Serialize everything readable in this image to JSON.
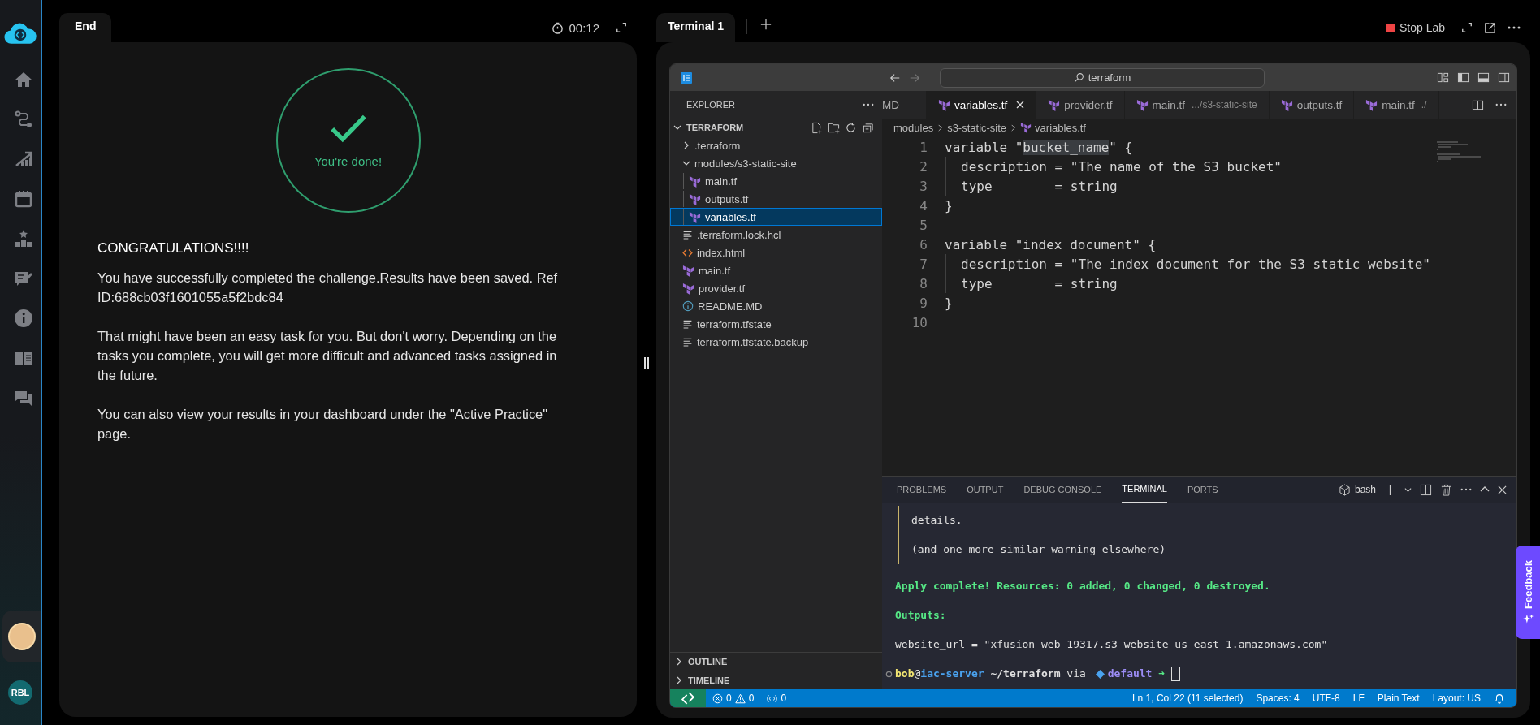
{
  "sidebar": {
    "user_badge": "RBL"
  },
  "left_panel": {
    "tab": "End",
    "timer": "00:12",
    "status": "You're done!",
    "heading": "CONGRATULATIONS!!!!",
    "paragraphs": [
      "You have successfully completed the challenge.Results have been saved. Ref ID:688cb03f1601055a5f2bdc84",
      "That might have been an easy task for you. But don't worry. Depending on the tasks you complete, you will get more difficult and advanced tasks assigned in the future.",
      "You can also view your results in your dashboard under the \"Active Practice\" page."
    ]
  },
  "right_panel": {
    "tab": "Terminal 1",
    "stop_button": "Stop Lab"
  },
  "editor": {
    "search": "terraform",
    "explorer": {
      "title": "EXPLORER",
      "section": "TERRAFORM",
      "tree": [
        {
          "label": ".terraform",
          "kind": "folder",
          "expanded": false,
          "selected": false
        },
        {
          "label": "modules/s3-static-site",
          "kind": "folder",
          "expanded": true,
          "selected": false,
          "children": [
            {
              "label": "main.tf",
              "kind": "tf",
              "selected": false
            },
            {
              "label": "outputs.tf",
              "kind": "tf",
              "selected": false
            },
            {
              "label": "variables.tf",
              "kind": "tf",
              "selected": true
            }
          ]
        },
        {
          "label": ".terraform.lock.hcl",
          "kind": "text",
          "selected": false
        },
        {
          "label": "index.html",
          "kind": "html",
          "selected": false
        },
        {
          "label": "main.tf",
          "kind": "tf",
          "selected": false
        },
        {
          "label": "provider.tf",
          "kind": "tf",
          "selected": false
        },
        {
          "label": "README.MD",
          "kind": "info",
          "selected": false
        },
        {
          "label": "terraform.tfstate",
          "kind": "text",
          "selected": false
        },
        {
          "label": "terraform.tfstate.backup",
          "kind": "text",
          "selected": false
        }
      ]
    },
    "bottom_sections": [
      {
        "label": "OUTLINE",
        "expanded": false
      },
      {
        "label": "TIMELINE",
        "expanded": false
      }
    ],
    "tabs": [
      {
        "label": "MD",
        "kind": "plain",
        "selected": false
      },
      {
        "label": "variables.tf",
        "kind": "tf",
        "selected": true
      },
      {
        "label": "provider.tf",
        "kind": "tf",
        "selected": false
      },
      {
        "label": "main.tf",
        "description": ".../s3-static-site",
        "kind": "tf",
        "selected": false
      },
      {
        "label": "outputs.tf",
        "kind": "tf",
        "selected": false
      },
      {
        "label": "main.tf",
        "description": "./",
        "kind": "tf",
        "selected": false
      }
    ],
    "breadcrumb": [
      "modules",
      "s3-static-site",
      "variables.tf"
    ],
    "code": [
      {
        "number": "1",
        "kind": "top",
        "parts": [
          {
            "text": "variable \"",
            "selected": false
          },
          {
            "text": "bucket_name",
            "selected": true
          },
          {
            "text": "\" {",
            "selected": false
          }
        ]
      },
      {
        "number": "2",
        "kind": "block",
        "parts": [
          {
            "text": "description = \"The name of the S3 bucket\"",
            "selected": false
          }
        ]
      },
      {
        "number": "3",
        "kind": "block",
        "parts": [
          {
            "text": "type        = string",
            "selected": false
          }
        ]
      },
      {
        "number": "4",
        "kind": "top",
        "parts": [
          {
            "text": "}",
            "selected": false
          }
        ]
      },
      {
        "number": "5",
        "kind": "top"
      },
      {
        "number": "6",
        "kind": "top",
        "parts": [
          {
            "text": "variable \"index_document\" {",
            "selected": false
          }
        ]
      },
      {
        "number": "7",
        "kind": "block",
        "parts": [
          {
            "text": "description = \"The index document for the S3 static website\"",
            "selected": false
          }
        ]
      },
      {
        "number": "8",
        "kind": "block",
        "parts": [
          {
            "text": "type        = string",
            "selected": false
          }
        ]
      },
      {
        "number": "9",
        "kind": "top",
        "parts": [
          {
            "text": "}",
            "selected": false
          }
        ]
      },
      {
        "number": "10",
        "kind": "top"
      }
    ]
  },
  "panel": {
    "tabs": [
      {
        "label": "PROBLEMS",
        "selected": false
      },
      {
        "label": "OUTPUT",
        "selected": false
      },
      {
        "label": "DEBUG CONSOLE",
        "selected": false
      },
      {
        "label": "TERMINAL",
        "selected": true
      },
      {
        "label": "PORTS",
        "selected": false
      }
    ],
    "shell": "bash",
    "output": [
      {
        "kind": "quote",
        "text": "details."
      },
      {
        "kind": "quote",
        "text": "(and one more similar warning elsewhere)"
      },
      {
        "kind": "success",
        "text": "Apply complete! Resources: 0 added, 0 changed, 0 destroyed."
      },
      {
        "kind": "success",
        "text": "Outputs:"
      },
      {
        "kind": "plain",
        "text": "website_url = \"xfusion-web-19317.s3-website-us-east-1.amazonaws.com\""
      }
    ],
    "prompt": [
      {
        "kind": "user",
        "text": "bob"
      },
      {
        "kind": "plain",
        "text": "@"
      },
      {
        "kind": "host",
        "text": "iac-server"
      },
      {
        "kind": "path",
        "text": " ~/terraform"
      },
      {
        "kind": "plain",
        "text": " via "
      },
      {
        "kind": "env",
        "text": "default"
      },
      {
        "kind": "arrow",
        "text": " ➜"
      }
    ]
  },
  "status_bar": {
    "errors": "0",
    "warnings": "0",
    "ports": "0",
    "items": [
      "Ln 1, Col 22 (11 selected)",
      "Spaces: 4",
      "UTF-8",
      "LF",
      "Plain Text",
      "Layout: US"
    ]
  },
  "feedback": "Feedback"
}
